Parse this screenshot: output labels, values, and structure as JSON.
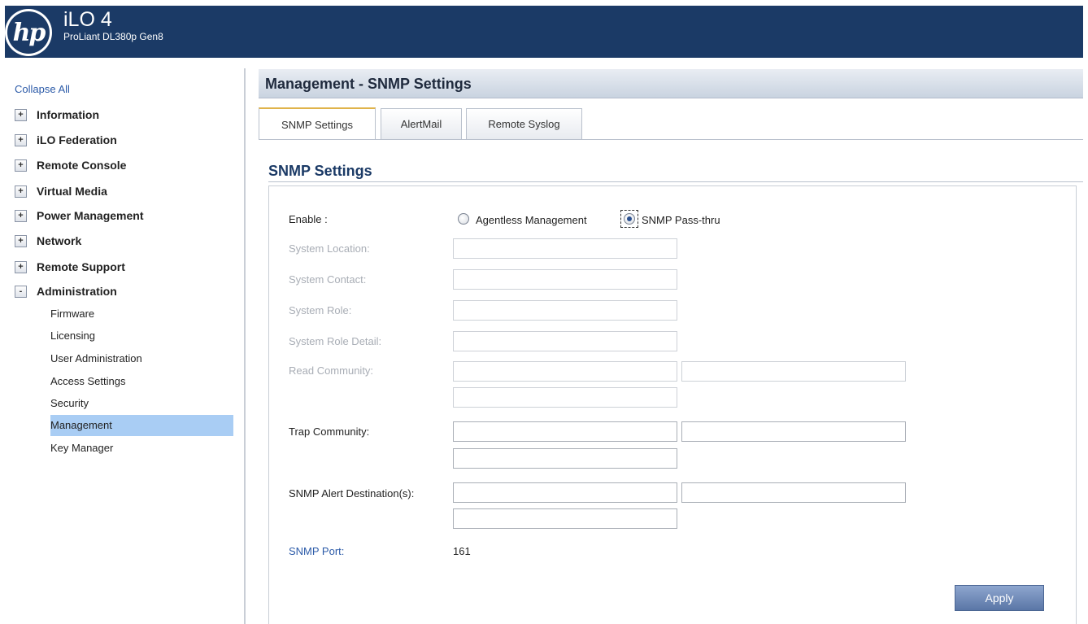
{
  "header": {
    "logo_text": "hp",
    "product_title": "iLO 4",
    "product_subtitle": "ProLiant DL380p Gen8"
  },
  "sidebar": {
    "collapse_all": "Collapse All",
    "sections": [
      {
        "expander": "+",
        "label": "Information"
      },
      {
        "expander": "+",
        "label": "iLO Federation"
      },
      {
        "expander": "+",
        "label": "Remote Console"
      },
      {
        "expander": "+",
        "label": "Virtual Media"
      },
      {
        "expander": "+",
        "label": "Power Management"
      },
      {
        "expander": "+",
        "label": "Network"
      },
      {
        "expander": "+",
        "label": "Remote Support"
      },
      {
        "expander": "-",
        "label": "Administration"
      }
    ],
    "admin_items": [
      "Firmware",
      "Licensing",
      "User Administration",
      "Access Settings",
      "Security",
      "Management",
      "Key Manager"
    ],
    "selected_item": "Management"
  },
  "main": {
    "title": "Management - SNMP Settings",
    "tabs": [
      {
        "label": "SNMP Settings",
        "active": true
      },
      {
        "label": "AlertMail",
        "active": false
      },
      {
        "label": "Remote Syslog",
        "active": false
      }
    ],
    "section_title": "SNMP Settings",
    "form": {
      "enable_label": "Enable :",
      "enable_options": [
        {
          "label": "Agentless Management",
          "selected": false
        },
        {
          "label": "SNMP Pass-thru",
          "selected": true
        }
      ],
      "system_location_label": "System Location:",
      "system_location_value": "",
      "system_contact_label": "System Contact:",
      "system_contact_value": "",
      "system_role_label": "System Role:",
      "system_role_value": "",
      "system_role_detail_label": "System Role Detail:",
      "system_role_detail_value": "",
      "read_community_label": "Read Community:",
      "read_community_values": [
        "",
        "",
        ""
      ],
      "trap_community_label": "Trap Community:",
      "trap_community_values": [
        "",
        "",
        ""
      ],
      "alert_destinations_label": "SNMP Alert Destination(s):",
      "alert_destination_values": [
        "",
        "",
        ""
      ],
      "snmp_port_label": "SNMP Port:",
      "snmp_port_value": "161"
    },
    "apply_label": "Apply"
  },
  "colors": {
    "header_bg": "#1b3a66",
    "selected_item_bg": "#a9cdf4",
    "link_blue": "#2b5aa8"
  }
}
